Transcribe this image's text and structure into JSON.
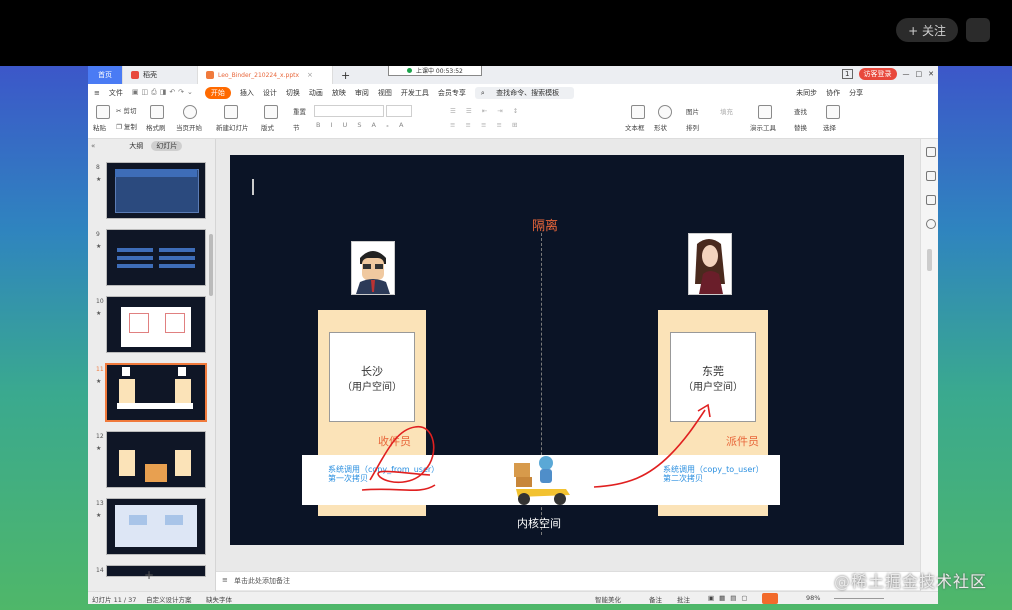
{
  "recorder": {
    "pill_label": "+ 关注"
  },
  "tabs": {
    "home": "首页",
    "items": [
      {
        "label": "稻壳",
        "icon": "docer-icon"
      },
      {
        "label": "Leo_Binder_210224_x.pptx",
        "icon": "pptx-icon"
      }
    ],
    "add": "+"
  },
  "rec_timer": "上课中 00:53:52",
  "window": {
    "badge": "1",
    "login": "访客登录"
  },
  "menu": {
    "file": "文件",
    "items": [
      "开始",
      "插入",
      "设计",
      "切换",
      "动画",
      "放映",
      "审阅",
      "视图",
      "开发工具",
      "会员专享"
    ],
    "search": "查找命令、搜索模板",
    "sync": "未同步",
    "collab": "协作",
    "share": "分享"
  },
  "ribbon": {
    "paste": "粘贴",
    "cut": "剪切",
    "copy": "复制",
    "format_painter": "格式刷",
    "start_from": "当页开始",
    "new_slide": "新建幻灯片",
    "layout": "版式",
    "section": "节",
    "reset": "重置",
    "textbox": "文本框",
    "shape": "形状",
    "arrange": "排列",
    "picture": "图片",
    "fill": "填充",
    "present": "演示工具",
    "find": "查找",
    "replace": "替换",
    "select": "选择"
  },
  "left_panel": {
    "outline": "大纲",
    "slides": "幻灯片",
    "add": "+"
  },
  "thumbnails": [
    {
      "num": "8",
      "star": "★"
    },
    {
      "num": "9",
      "star": "★"
    },
    {
      "num": "10",
      "star": "★"
    },
    {
      "num": "11",
      "star": "★"
    },
    {
      "num": "12",
      "star": "★"
    },
    {
      "num": "13",
      "star": "★"
    },
    {
      "num": "14",
      "star": ""
    }
  ],
  "slide": {
    "isolation": "隔离",
    "left_box": {
      "line1": "长沙",
      "line2": "（用户空间）"
    },
    "right_box": {
      "line1": "东莞",
      "line2": "（用户空间）"
    },
    "courier_left": "收件员",
    "courier_right": "派件员",
    "sys_left": {
      "line1": "系统调用（copy_from_user）",
      "line2": "第一次拷贝"
    },
    "sys_right": {
      "line1": "系统调用（copy_to_user）",
      "line2": "第二次拷贝"
    },
    "kernel": "内核空间"
  },
  "notes_placeholder": "单击此处添加备注",
  "status": {
    "slide_pos": "幻灯片 11 / 37",
    "design": "自定义设计方案",
    "font_missing": "缺失字体",
    "beautify": "智能美化",
    "notes": "备注",
    "comment": "批注",
    "zoom": "98%"
  },
  "watermark": "@稀土掘金技术社区"
}
